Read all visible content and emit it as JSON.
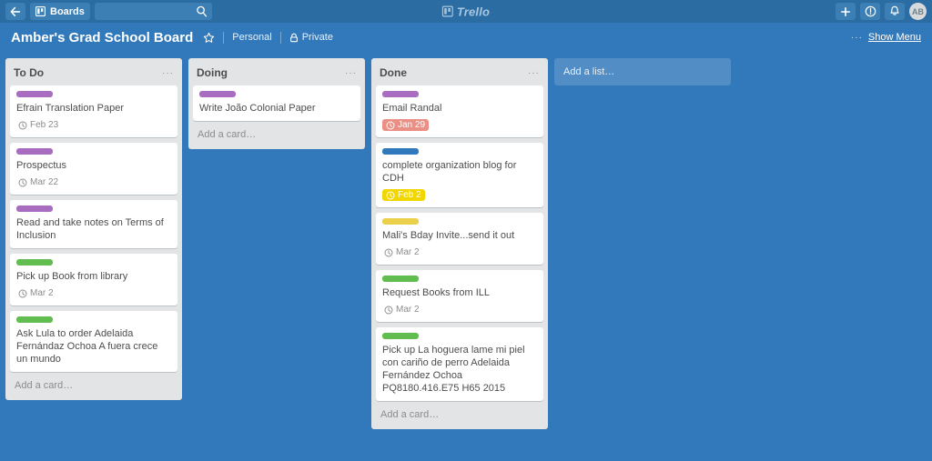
{
  "topbar": {
    "back_icon": "arrow-left-icon",
    "boards_label": "Boards",
    "search_value": "",
    "search_placeholder": "",
    "search_icon": "search-icon",
    "logo_text": "Trello",
    "add_icon": "plus-icon",
    "info_icon": "info-icon",
    "notifications_icon": "bell-icon",
    "avatar_initials": "AB"
  },
  "board_header": {
    "title": "Amber's Grad School Board",
    "star_icon": "star-icon",
    "team_label": "Personal",
    "visibility_label": "Private",
    "visibility_icon": "lock-icon",
    "menu_dots": "···",
    "show_menu_label": "Show Menu"
  },
  "colors": {
    "board_bg": "#3179ba",
    "topbar_bg": "#2b6ca3",
    "list_bg": "#e2e4e6",
    "label_purple": "#a86cc1",
    "label_green": "#61bd4f",
    "label_blue": "#3179bd",
    "label_yellow": "#ebd14b",
    "badge_overdue": "#eb8f85",
    "badge_due_soon": "#f2d600"
  },
  "add_list": {
    "placeholder": "Add a list…"
  },
  "lists": [
    {
      "title": "To Do",
      "add_card_label": "Add a card…",
      "cards": [
        {
          "label_color": "#a86cc1",
          "title": "Efrain Translation Paper",
          "due": "Feb 23",
          "due_state": "plain"
        },
        {
          "label_color": "#a86cc1",
          "title": "Prospectus",
          "due": "Mar 22",
          "due_state": "plain"
        },
        {
          "label_color": "#a86cc1",
          "title": "Read and take notes on Terms of Inclusion",
          "due": "",
          "due_state": "none"
        },
        {
          "label_color": "#61bd4f",
          "title": "Pick up Book from library",
          "due": "Mar 2",
          "due_state": "plain"
        },
        {
          "label_color": "#61bd4f",
          "title": "Ask Lula to order Adelaida Fernándaz Ochoa A fuera crece un mundo",
          "due": "",
          "due_state": "none"
        }
      ]
    },
    {
      "title": "Doing",
      "add_card_label": "Add a card…",
      "cards": [
        {
          "label_color": "#a86cc1",
          "title": "Write João Colonial Paper",
          "due": "",
          "due_state": "none"
        }
      ]
    },
    {
      "title": "Done",
      "add_card_label": "Add a card…",
      "cards": [
        {
          "label_color": "#a86cc1",
          "title": "Email Randal",
          "due": "Jan 29",
          "due_state": "overdue"
        },
        {
          "label_color": "#3179bd",
          "title": "complete organization blog for CDH",
          "due": "Feb 2",
          "due_state": "due-soon"
        },
        {
          "label_color": "#ebd14b",
          "title": "Mali's Bday Invite...send it out",
          "due": "Mar 2",
          "due_state": "plain"
        },
        {
          "label_color": "#61bd4f",
          "title": "Request Books from ILL",
          "due": "Mar 2",
          "due_state": "plain"
        },
        {
          "label_color": "#61bd4f",
          "title": "Pick up La hoguera lame mi piel con cariño de perro Adelaida Fernández Ochoa PQ8180.416.E75 H65 2015",
          "due": "",
          "due_state": "none"
        }
      ]
    }
  ]
}
